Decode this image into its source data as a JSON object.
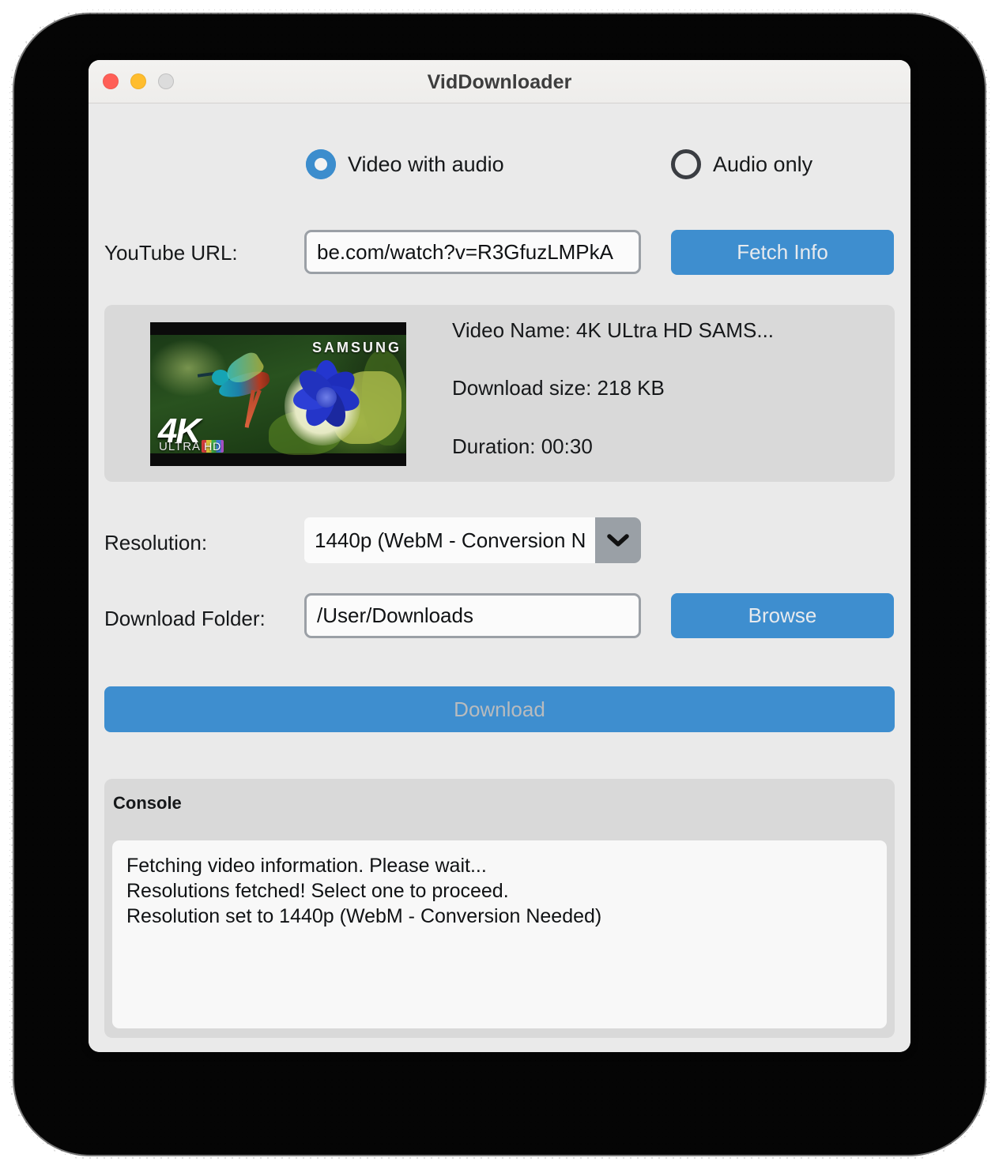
{
  "window": {
    "title": "VidDownloader",
    "traffic_lights": [
      "close",
      "minimize",
      "maximize"
    ]
  },
  "mode_options": [
    {
      "label": "Video with audio",
      "selected": true
    },
    {
      "label": "Audio only",
      "selected": false
    }
  ],
  "url_row": {
    "label": "YouTube URL:",
    "value": "be.com/watch?v=R3GfuzLMPkA",
    "button": "Fetch Info"
  },
  "info_panel": {
    "thumbnail": {
      "brand_text": "SAMSUNG",
      "quality_text": "4K",
      "quality_sub": "ULTRA",
      "hd_badge": "HD"
    },
    "video_name": "Video Name: 4K ULtra HD  SAMS...",
    "download_size": "Download size: 218 KB",
    "duration": "Duration: 00:30"
  },
  "resolution_row": {
    "label": "Resolution:",
    "value": "1440p (WebM - Conversion N",
    "full_value": "1440p (WebM - Conversion Needed)"
  },
  "folder_row": {
    "label": "Download Folder:",
    "value": "/User/Downloads",
    "button": "Browse"
  },
  "download_button": {
    "label": "Download"
  },
  "console": {
    "title": "Console",
    "lines": [
      "Fetching video information. Please wait...",
      "Resolutions fetched! Select one to proceed.",
      "Resolution set to 1440p (WebM - Conversion Needed)"
    ]
  },
  "colors": {
    "accent_blue": "#3e8ecf",
    "window_bg": "#eaeaea",
    "panel_bg": "#d9d9d9",
    "titlebar_bg": "#f0efed",
    "close_red": "#ff5f57",
    "minimize_yellow": "#ffbd2e",
    "maximize_gray": "#dcdcdc",
    "radio_selected": "#3c8dcd",
    "radio_unselected": "#3a3d42",
    "console_bg": "#f8f8f8",
    "disabled_text": "#b8bbbe"
  }
}
